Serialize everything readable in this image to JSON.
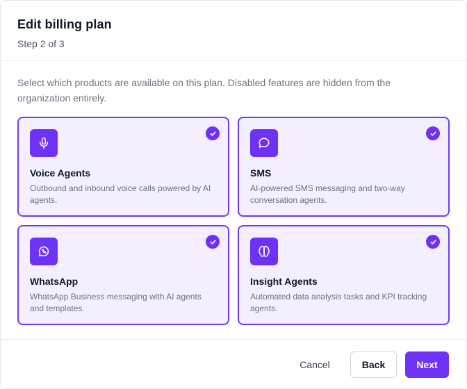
{
  "header": {
    "title": "Edit billing plan",
    "step": "Step 2 of 3"
  },
  "description": "Select which products are available on this plan. Disabled features are hidden from the organization entirely.",
  "accent_color": "#6d32f5",
  "products": [
    {
      "name": "Voice Agents",
      "description": "Outbound and inbound voice calls powered by AI agents.",
      "icon": "microphone-icon",
      "selected": true
    },
    {
      "name": "SMS",
      "description": "AI-powered SMS messaging and two-way conversation agents.",
      "icon": "chat-bubble-icon",
      "selected": true
    },
    {
      "name": "WhatsApp",
      "description": "WhatsApp Business messaging with AI agents and templates.",
      "icon": "whatsapp-icon",
      "selected": true
    },
    {
      "name": "Insight Agents",
      "description": "Automated data analysis tasks and KPI tracking agents.",
      "icon": "brain-icon",
      "selected": true
    }
  ],
  "footer": {
    "cancel_label": "Cancel",
    "back_label": "Back",
    "next_label": "Next"
  }
}
